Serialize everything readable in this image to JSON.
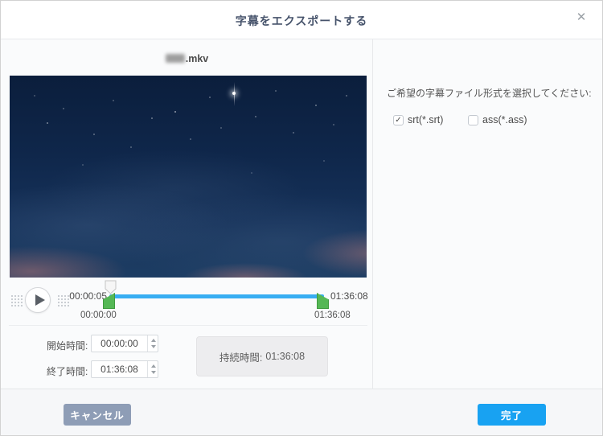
{
  "dialog": {
    "title": "字幕をエクスポートする"
  },
  "icons": {
    "close": "✕",
    "check": "✓",
    "play": "play-triangle"
  },
  "colors": {
    "accent_blue": "#18a2f2",
    "cancel_button": "#8e9db6",
    "track_blue": "#38aef2",
    "trim_handle_green": "#55b855"
  },
  "preview": {
    "filename_ext": ".mkv"
  },
  "transport": {
    "current_time": "00:00:05",
    "total_time": "01:36:08",
    "trim_start_time": "00:00:00",
    "trim_end_time": "01:36:08"
  },
  "time_fields": {
    "start_label": "開始時間:",
    "start_value": "00:00:00",
    "end_label": "終了時間:",
    "end_value": "01:36:08",
    "duration_label": "持続時間:",
    "duration_value": "01:36:08"
  },
  "format_panel": {
    "prompt": "ご希望の字幕ファイル形式を選択してください:",
    "options": [
      {
        "label": "srt(*.srt)",
        "checked": true
      },
      {
        "label": "ass(*.ass)",
        "checked": false
      }
    ]
  },
  "footer": {
    "cancel_label": "キャンセル",
    "done_label": "完了"
  }
}
